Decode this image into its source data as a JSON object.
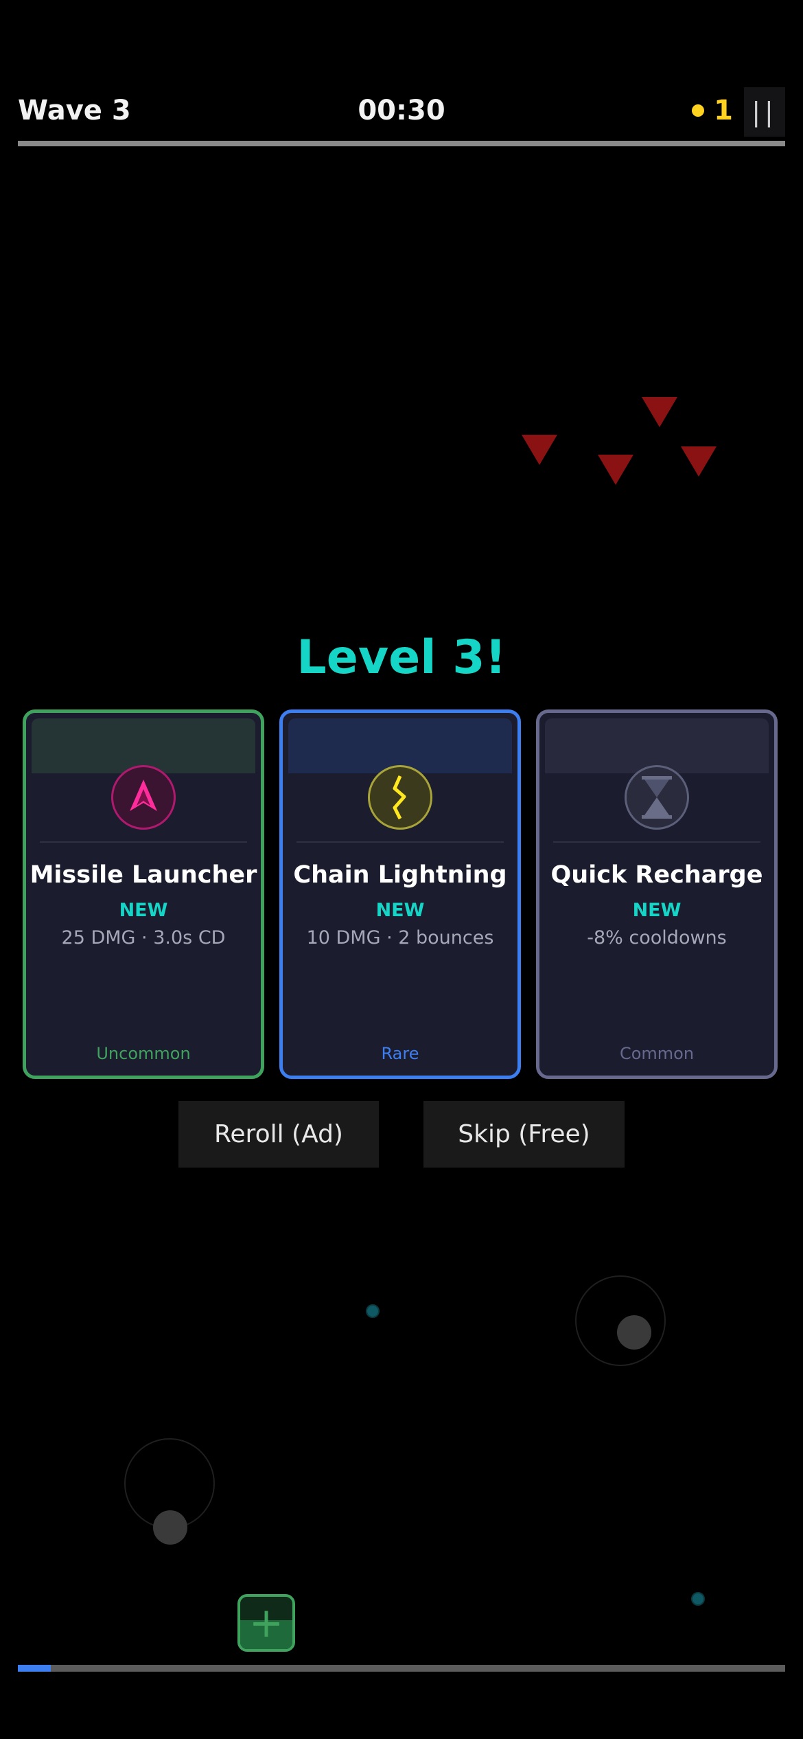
{
  "hud": {
    "wave_label": "Wave 3",
    "timer": "00:30",
    "coins": "1",
    "pause_label": "||",
    "wave_progress": 1.0
  },
  "level_up": {
    "title": "Level 3!",
    "cards": [
      {
        "name": "Missile Launcher",
        "tag": "NEW",
        "stats": "25 DMG · 3.0s CD",
        "rarity": "Uncommon",
        "icon": "missile-icon"
      },
      {
        "name": "Chain Lightning",
        "tag": "NEW",
        "stats": "10 DMG · 2 bounces",
        "rarity": "Rare",
        "icon": "lightning-icon"
      },
      {
        "name": "Quick Recharge",
        "tag": "NEW",
        "stats": "-8% cooldowns",
        "rarity": "Common",
        "icon": "hourglass-icon"
      }
    ],
    "reroll_label": "Reroll (Ad)",
    "skip_label": "Skip (Free)"
  },
  "xp_progress": 0.043,
  "player_charge": 0.55,
  "colors": {
    "accent": "#15d6c6",
    "uncommon": "#3fa35e",
    "rare": "#3d7ef0",
    "common": "#676a8e",
    "coin": "#ffd21f",
    "enemy": "#8b1212"
  }
}
